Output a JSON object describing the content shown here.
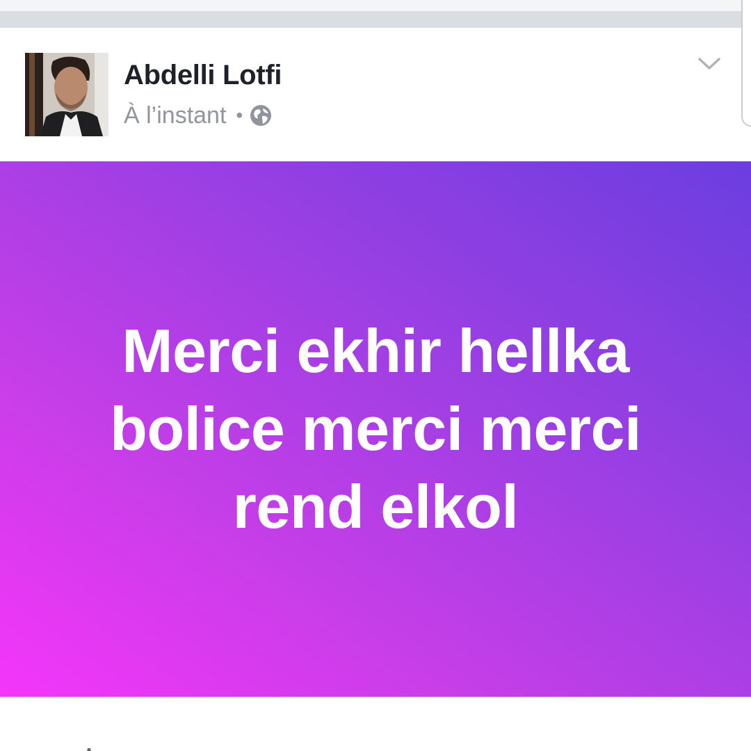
{
  "post": {
    "author_name": "Abdelli Lotfi",
    "timestamp": "À l’instant",
    "separator": "•",
    "privacy_icon": "globe-icon",
    "menu_icon": "chevron-down-icon",
    "status_text": "Merci ekhir hellka bolice merci merci rend elkol"
  },
  "colors": {
    "card_gradient_start": "#f535fa",
    "card_gradient_end": "#6b3edf",
    "name_color": "#1d2129",
    "meta_color": "#90949c"
  }
}
